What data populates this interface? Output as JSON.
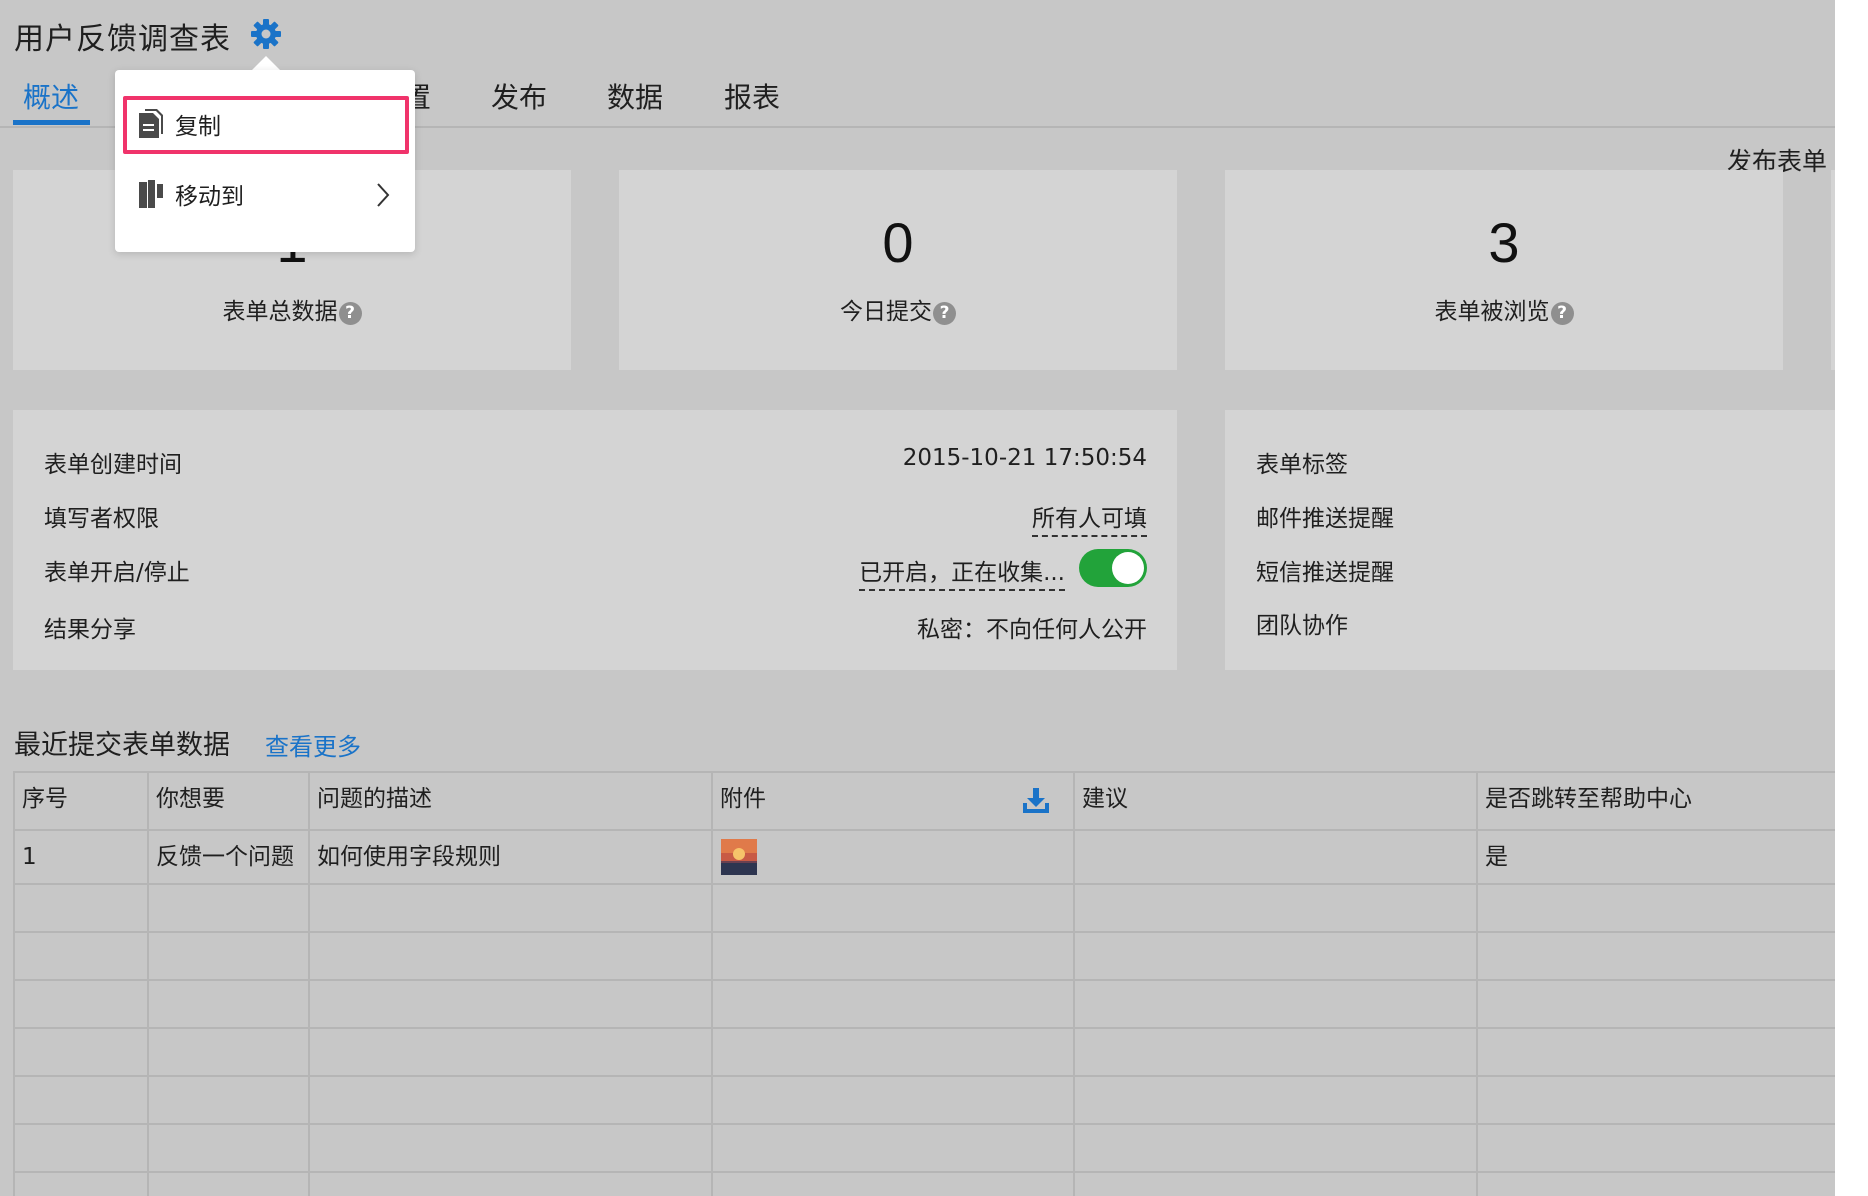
{
  "header": {
    "title": "用户反馈调查表",
    "publish_form_label": "发布表单",
    "icons": {
      "settings": "gear-icon"
    }
  },
  "tabs": [
    {
      "label": "概述",
      "active": true
    },
    {
      "label": "设置",
      "active": false
    },
    {
      "label": "发布",
      "active": false
    },
    {
      "label": "数据",
      "active": false
    },
    {
      "label": "报表",
      "active": false
    }
  ],
  "dropdown_menu": {
    "items": [
      {
        "label": "复制",
        "icon": "copy-icon",
        "highlighted": true
      },
      {
        "label": "移动到",
        "icon": "folder-move-icon",
        "has_submenu": true
      }
    ]
  },
  "stats": [
    {
      "value": "1",
      "label": "表单总数据"
    },
    {
      "value": "0",
      "label": "今日提交"
    },
    {
      "value": "3",
      "label": "表单被浏览"
    }
  ],
  "info": {
    "created_label": "表单创建时间",
    "created_value": "2015-10-21 17:50:54",
    "permission_label": "填写者权限",
    "permission_value": "所有人可填",
    "status_label": "表单开启/停止",
    "status_value": "已开启，正在收集...",
    "status_enabled": true,
    "share_label": "结果分享",
    "share_value": "私密：不向任何人公开"
  },
  "settings_panel": {
    "items": [
      "表单标签",
      "邮件推送提醒",
      "短信推送提醒",
      "团队协作"
    ]
  },
  "recent": {
    "title": "最近提交表单数据",
    "view_more": "查看更多"
  },
  "table": {
    "columns": [
      "序号",
      "你想要",
      "问题的描述",
      "附件",
      "建议",
      "是否跳转至帮助中心"
    ],
    "rows": [
      [
        "1",
        "反馈一个问题",
        "如何使用字段规则",
        "",
        "",
        "是"
      ]
    ]
  },
  "colors": {
    "accent": "#1a73c8",
    "toggle_on": "#22a33a",
    "highlight_border": "#f0336b"
  }
}
